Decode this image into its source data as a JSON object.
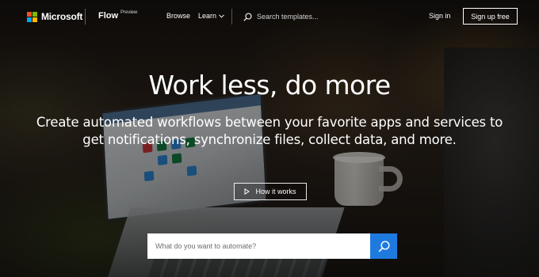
{
  "header": {
    "brand": "Microsoft",
    "product": "Flow",
    "product_badge": "Preview",
    "nav": [
      {
        "label": "Browse"
      },
      {
        "label": "Learn",
        "icon": "chevron-down-icon"
      }
    ],
    "search": {
      "placeholder": "Search templates...",
      "value": "",
      "icon": "search-icon"
    },
    "sign_in_label": "Sign in",
    "sign_up_label": "Sign up free"
  },
  "hero": {
    "title": "Work less, do more",
    "subtitle_line1": "Create automated workflows between your favorite apps and services to",
    "subtitle_line2": "get notifications, synchronize files, collect data, and more.",
    "how_it_works_label": "How it works",
    "how_it_works_icon": "play-icon",
    "automate": {
      "placeholder": "What do you want to automate?",
      "value": "",
      "button_icon": "search-icon"
    }
  },
  "colors": {
    "accent": "#1f7ae0",
    "ms_red": "#f25022",
    "ms_green": "#7fba00",
    "ms_blue": "#00a4ef",
    "ms_yellow": "#ffb900"
  }
}
